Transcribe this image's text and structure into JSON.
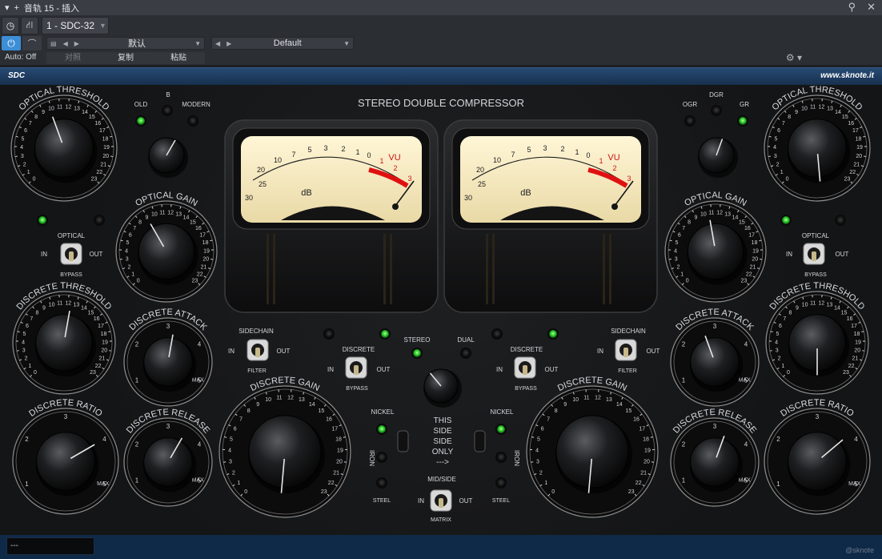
{
  "window": {
    "title": "音轨 15 - 插入",
    "pin_icon": "pin-icon",
    "close_icon": "close-icon"
  },
  "toolbar": {
    "instance_tab": "1 - SDC-32",
    "auto_label": "Auto: Off",
    "preset_left": "默认",
    "preset_right": "Default",
    "compare_label": "对照",
    "copy_label": "复制",
    "paste_label": "粘贴"
  },
  "brand": {
    "left": "SDC",
    "right": "www.sknote.it"
  },
  "plugin": {
    "title": "STEREO DOUBLE COMPRESSOR",
    "left": {
      "optical_threshold": "OPTICAL THRESHOLD",
      "optical_gain": "OPTICAL GAIN",
      "discrete_threshold": "DISCRETE THRESHOLD",
      "discrete_attack": "DISCRETE ATTACK",
      "discrete_release": "DISCRETE RELEASE",
      "discrete_ratio": "DISCRETE RATIO",
      "discrete_gain": "DISCRETE GAIN",
      "mode_old": "OLD",
      "mode_b": "B",
      "mode_modern": "MODERN",
      "optical": "OPTICAL",
      "bypass": "BYPASS",
      "in": "IN",
      "out": "OUT",
      "sidechain": "SIDECHAIN",
      "filter": "FILTER",
      "discrete": "DISCRETE",
      "discrete_bypass": "BYPASS",
      "nickel": "NICKEL",
      "iron": "IRON",
      "steel": "STEEL"
    },
    "right": {
      "optical_threshold": "OPTICAL THRESHOLD",
      "optical_gain": "OPTICAL GAIN",
      "discrete_threshold": "DISCRETE THRESHOLD",
      "discrete_attack": "DISCRETE ATTACK",
      "discrete_release": "DISCRETE RELEASE",
      "discrete_ratio": "DISCRETE RATIO",
      "discrete_gain": "DISCRETE GAIN",
      "mode_ogr": "OGR",
      "mode_dgr": "DGR",
      "mode_gr": "GR",
      "optical": "OPTICAL",
      "bypass": "BYPASS",
      "in": "IN",
      "out": "OUT",
      "sidechain": "SIDECHAIN",
      "filter": "FILTER",
      "discrete": "DISCRETE",
      "discrete_bypass": "BYPASS",
      "nickel": "NICKEL",
      "iron": "IRON",
      "steel": "STEEL"
    },
    "center": {
      "stereo": "STEREO",
      "dual": "DUAL",
      "info_1": "THIS",
      "info_2": "SIDE",
      "info_3": "SIDE",
      "info_4": "ONLY",
      "info_5": "--->",
      "midside": "MID/SIDE",
      "matrix": "MATRIX",
      "in": "IN",
      "out": "OUT"
    },
    "vu": {
      "label": "VU",
      "unit": "dB",
      "scale": [
        "30",
        "25",
        "20",
        "10",
        "7",
        "5",
        "3",
        "2",
        "1",
        "0",
        "1",
        "2",
        "3",
        "20",
        "15",
        "10",
        "5",
        "3"
      ]
    },
    "scale_labels": {
      "max": "MAX"
    }
  },
  "footer": {
    "value": "---",
    "copyright": "@sknote"
  }
}
